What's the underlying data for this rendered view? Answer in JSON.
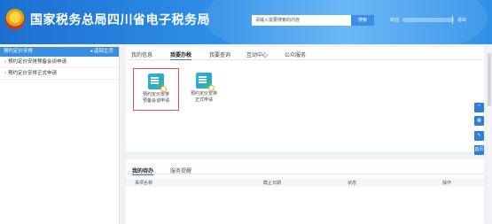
{
  "header": {
    "title": "国家税务总局四川省电子税务局",
    "search_placeholder": "请输入需要搜索的内容",
    "search_button": "搜索",
    "welcome": "欢迎,",
    "logout": "退出",
    "colors": {
      "bar": "#2f8fe8",
      "accent": "#3a8ee6"
    }
  },
  "sidebar": {
    "title": "预约定价安排",
    "back": "◂ 返回主页",
    "items": [
      {
        "label": "› 预约定价安排预备会谈申请"
      },
      {
        "label": "› 预约定价安排正式申请"
      }
    ]
  },
  "main": {
    "tabs": [
      "我的信息",
      "我要办税",
      "我要查询",
      "互动中心",
      "公众服务"
    ],
    "active_tab": "我要办税",
    "tiles": [
      {
        "line1": "预约定价安排",
        "line2": "预备会谈申请",
        "icon": "document-search-icon",
        "selected": true
      },
      {
        "line1": "预约定价安排",
        "line2": "正式申请",
        "icon": "document-search-icon",
        "selected": false
      }
    ]
  },
  "tools": [
    "^",
    "▦",
    "✎",
    "首页"
  ],
  "bottom": {
    "tabs": [
      "我的待办",
      "服务提醒"
    ],
    "columns": [
      "事项名称",
      "截止日期",
      "状态",
      "操作"
    ]
  }
}
